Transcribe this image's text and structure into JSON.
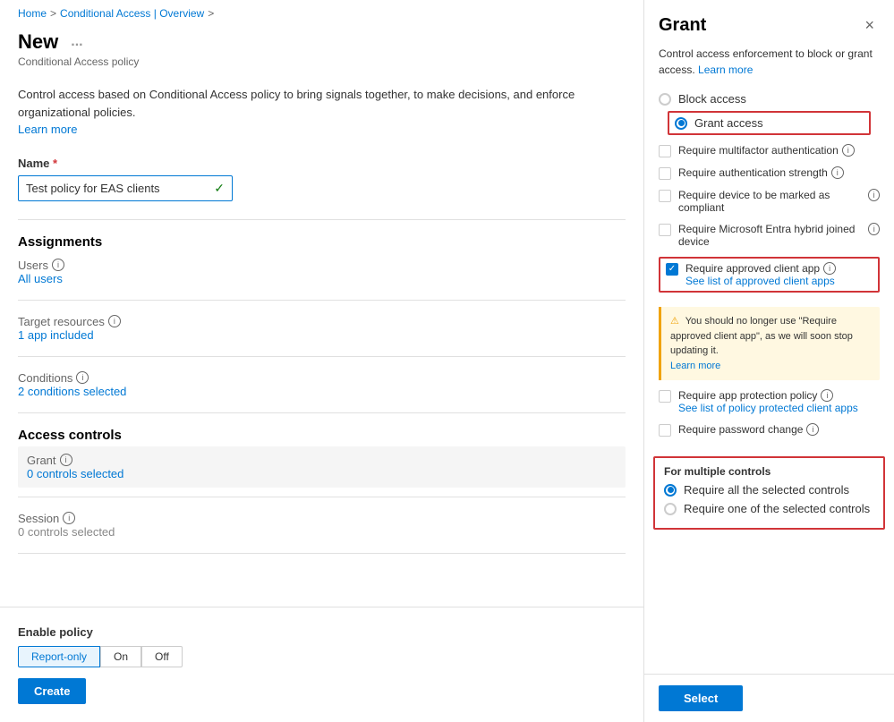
{
  "breadcrumb": {
    "home": "Home",
    "separator1": ">",
    "conditional_access": "Conditional Access | Overview",
    "separator2": ">"
  },
  "page": {
    "title": "New",
    "ellipsis": "...",
    "subtitle": "Conditional Access policy"
  },
  "description": {
    "text": "Control access based on Conditional Access policy to bring signals together, to make decisions, and enforce organizational policies.",
    "learn_more": "Learn more"
  },
  "form": {
    "name_label": "Name",
    "name_required": "*",
    "name_value": "Test policy for EAS clients",
    "name_checkmark": "✓"
  },
  "assignments": {
    "title": "Assignments",
    "users_label": "Users",
    "users_value": "All users",
    "target_label": "Target resources",
    "target_value": "1 app included",
    "conditions_label": "Conditions",
    "conditions_value": "2 conditions selected"
  },
  "access_controls": {
    "title": "Access controls",
    "grant_label": "Grant",
    "grant_value": "0 controls selected",
    "session_label": "Session",
    "session_value": "0 controls selected"
  },
  "enable_policy": {
    "label": "Enable policy",
    "options": [
      "Report-only",
      "On",
      "Off"
    ],
    "active_option": "Report-only"
  },
  "create_button": "Create",
  "right_panel": {
    "title": "Grant",
    "close_icon": "×",
    "description": "Control access enforcement to block or grant access.",
    "learn_more": "Learn more",
    "block_access": "Block access",
    "grant_access": "Grant access",
    "checkboxes": [
      {
        "id": "mfa",
        "label": "Require multifactor authentication",
        "checked": false,
        "has_info": true
      },
      {
        "id": "auth_strength",
        "label": "Require authentication strength",
        "checked": false,
        "has_info": true
      },
      {
        "id": "compliant",
        "label": "Require device to be marked as compliant",
        "checked": false,
        "has_info": true
      },
      {
        "id": "hybrid",
        "label": "Require Microsoft Entra hybrid joined device",
        "checked": false,
        "has_info": true
      },
      {
        "id": "approved_app",
        "label": "Require approved client app",
        "sublabel": "See list of approved client apps",
        "checked": true,
        "has_info": true,
        "highlighted": true
      },
      {
        "id": "app_protection",
        "label": "Require app protection policy",
        "sublabel": "See list of policy protected client apps",
        "checked": false,
        "has_info": true
      },
      {
        "id": "password_change",
        "label": "Require password change",
        "checked": false,
        "has_info": true
      }
    ],
    "warning": {
      "text": "You should no longer use \"Require approved client app\", as we will soon stop updating it.",
      "learn_more": "Learn more"
    },
    "multiple_controls": {
      "title": "For multiple controls",
      "options": [
        {
          "label": "Require all the selected controls",
          "checked": true
        },
        {
          "label": "Require one of the selected controls",
          "checked": false
        }
      ]
    },
    "select_button": "Select"
  }
}
